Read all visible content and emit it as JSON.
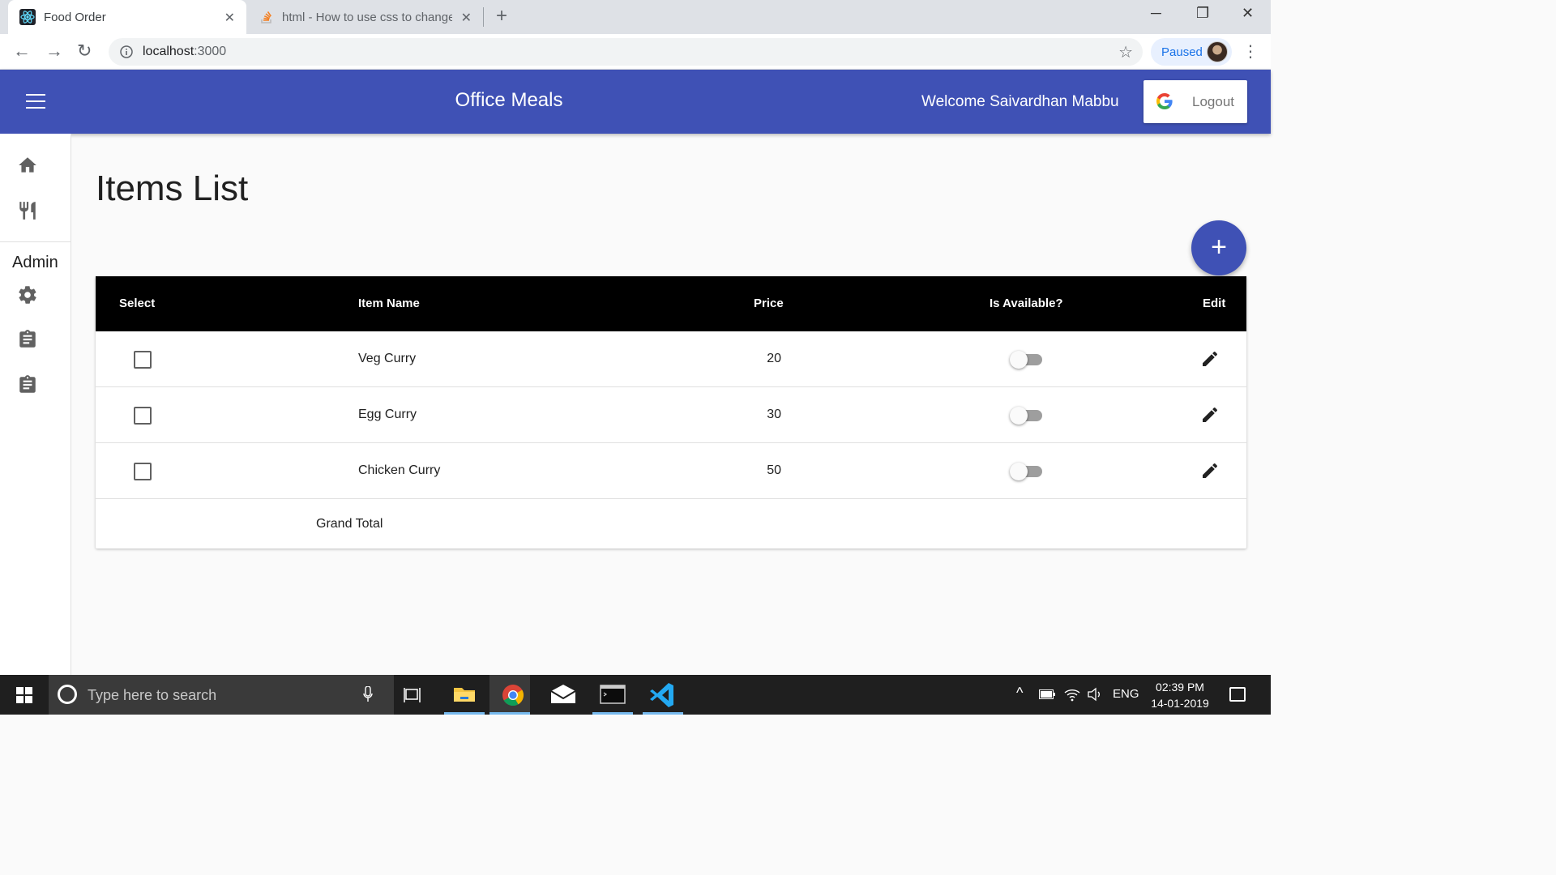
{
  "browser": {
    "tabs": [
      {
        "title": "Food Order",
        "icon": "react-icon"
      },
      {
        "title": "html - How to use css to change",
        "icon": "stackoverflow-icon"
      }
    ],
    "url_host": "localhost",
    "url_port": ":3000",
    "profile_status": "Paused"
  },
  "appbar": {
    "title": "Office Meals",
    "welcome": "Welcome Saivardhan Mabbu",
    "logout_label": "Logout",
    "color": "#3f51b5"
  },
  "sidebar": {
    "items": [
      {
        "icon": "home-icon"
      },
      {
        "icon": "restaurant-icon"
      }
    ],
    "section_label": "Admin",
    "admin_items": [
      {
        "icon": "settings-icon"
      },
      {
        "icon": "assignment-icon"
      },
      {
        "icon": "assignment-icon"
      }
    ]
  },
  "main": {
    "title": "Items List",
    "fab_label": "+",
    "table": {
      "headers": [
        "Select",
        "Item Name",
        "Price",
        "Is Available?",
        "Edit"
      ],
      "rows": [
        {
          "name": "Veg Curry",
          "price": "20",
          "selected": false,
          "available": false
        },
        {
          "name": "Egg Curry",
          "price": "30",
          "selected": false,
          "available": false
        },
        {
          "name": "Chicken Curry",
          "price": "50",
          "selected": false,
          "available": false
        }
      ],
      "footer_label": "Grand Total"
    }
  },
  "taskbar": {
    "search_placeholder": "Type here to search",
    "language": "ENG",
    "time": "02:39 PM",
    "date": "14-01-2019"
  }
}
